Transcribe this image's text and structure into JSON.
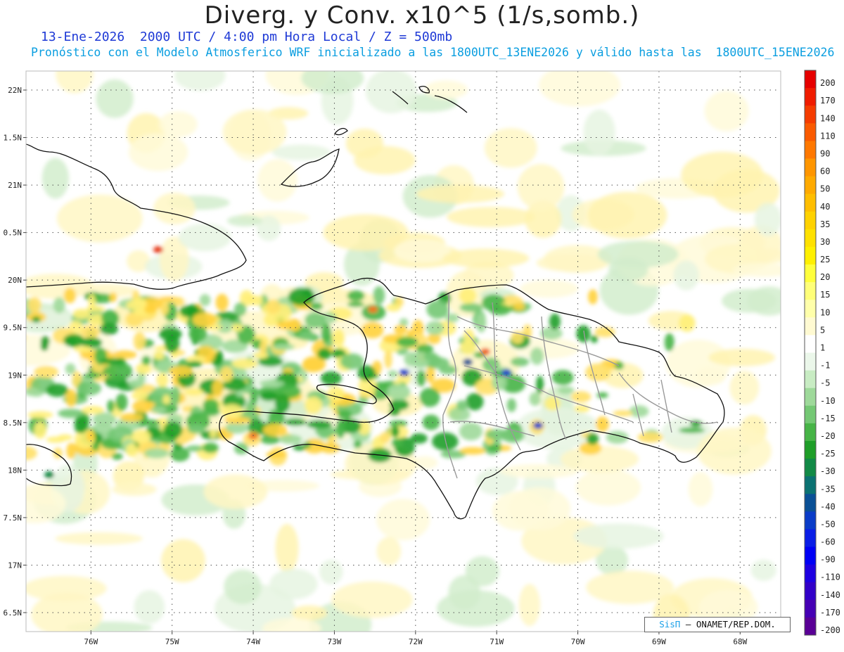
{
  "title": "Diverg. y Conv. x10^5 (1/s,somb.)",
  "subtitle_1": "13-Ene-2026  2000 UTC / 4:00 pm Hora Local / Z = 500mb",
  "subtitle_2": "Pronóstico con el Modelo Atmosferico WRF inicializado a las 1800UTC_13ENE2026 y válido hasta las  1800UTC_15ENE2026",
  "map": {
    "lon_range": [
      -76.8,
      -67.5
    ],
    "lat_range": [
      16.3,
      22.2
    ],
    "lat_labels": [
      {
        "lat": 22.0,
        "label": "22N"
      },
      {
        "lat": 21.5,
        "label": "1.5N"
      },
      {
        "lat": 21.0,
        "label": "21N"
      },
      {
        "lat": 20.5,
        "label": "0.5N"
      },
      {
        "lat": 20.0,
        "label": "20N"
      },
      {
        "lat": 19.5,
        "label": "9.5N"
      },
      {
        "lat": 19.0,
        "label": "19N"
      },
      {
        "lat": 18.5,
        "label": "8.5N"
      },
      {
        "lat": 18.0,
        "label": "18N"
      },
      {
        "lat": 17.5,
        "label": "7.5N"
      },
      {
        "lat": 17.0,
        "label": "17N"
      },
      {
        "lat": 16.5,
        "label": "6.5N"
      }
    ],
    "lon_labels": [
      {
        "lon": -76,
        "label": "76W"
      },
      {
        "lon": -75,
        "label": "75W"
      },
      {
        "lon": -74,
        "label": "74W"
      },
      {
        "lon": -73,
        "label": "73W"
      },
      {
        "lon": -72,
        "label": "72W"
      },
      {
        "lon": -71,
        "label": "71W"
      },
      {
        "lon": -70,
        "label": "70W"
      },
      {
        "lon": -69,
        "label": "69W"
      },
      {
        "lon": -68,
        "label": "68W"
      }
    ]
  },
  "colorbar": {
    "levels": [
      {
        "label": "200",
        "color": "#e60000"
      },
      {
        "label": "170",
        "color": "#f01c00"
      },
      {
        "label": "140",
        "color": "#f53c00"
      },
      {
        "label": "110",
        "color": "#fa5a00"
      },
      {
        "label": "90",
        "color": "#ff7800"
      },
      {
        "label": "60",
        "color": "#ff9600"
      },
      {
        "label": "50",
        "color": "#ffaa00"
      },
      {
        "label": "40",
        "color": "#ffbe00"
      },
      {
        "label": "35",
        "color": "#ffd200"
      },
      {
        "label": "30",
        "color": "#ffe100"
      },
      {
        "label": "25",
        "color": "#fff000"
      },
      {
        "label": "20",
        "color": "#ffff3c"
      },
      {
        "label": "15",
        "color": "#ffff78"
      },
      {
        "label": "10",
        "color": "#ffffaa"
      },
      {
        "label": "5",
        "color": "#fffad2"
      },
      {
        "label": "1",
        "color": "#ffffff"
      },
      {
        "label": "-1",
        "color": "#ebf7ea"
      },
      {
        "label": "-5",
        "color": "#c8ecc3"
      },
      {
        "label": "-10",
        "color": "#9ed99a"
      },
      {
        "label": "-15",
        "color": "#74c874"
      },
      {
        "label": "-20",
        "color": "#46b446"
      },
      {
        "label": "-25",
        "color": "#1e9e28"
      },
      {
        "label": "-30",
        "color": "#128a46"
      },
      {
        "label": "-35",
        "color": "#0b7272"
      },
      {
        "label": "-40",
        "color": "#0a5096"
      },
      {
        "label": "-50",
        "color": "#0a3cc8"
      },
      {
        "label": "-60",
        "color": "#0a1ee6"
      },
      {
        "label": "-90",
        "color": "#0000f5"
      },
      {
        "label": "-110",
        "color": "#1e00e1"
      },
      {
        "label": "-140",
        "color": "#3200c8"
      },
      {
        "label": "-170",
        "color": "#4600b4"
      },
      {
        "label": "-200",
        "color": "#5a0096"
      }
    ]
  },
  "credit": {
    "brand": "SisΠ",
    "text": " – ONAMET/REP.DOM."
  }
}
